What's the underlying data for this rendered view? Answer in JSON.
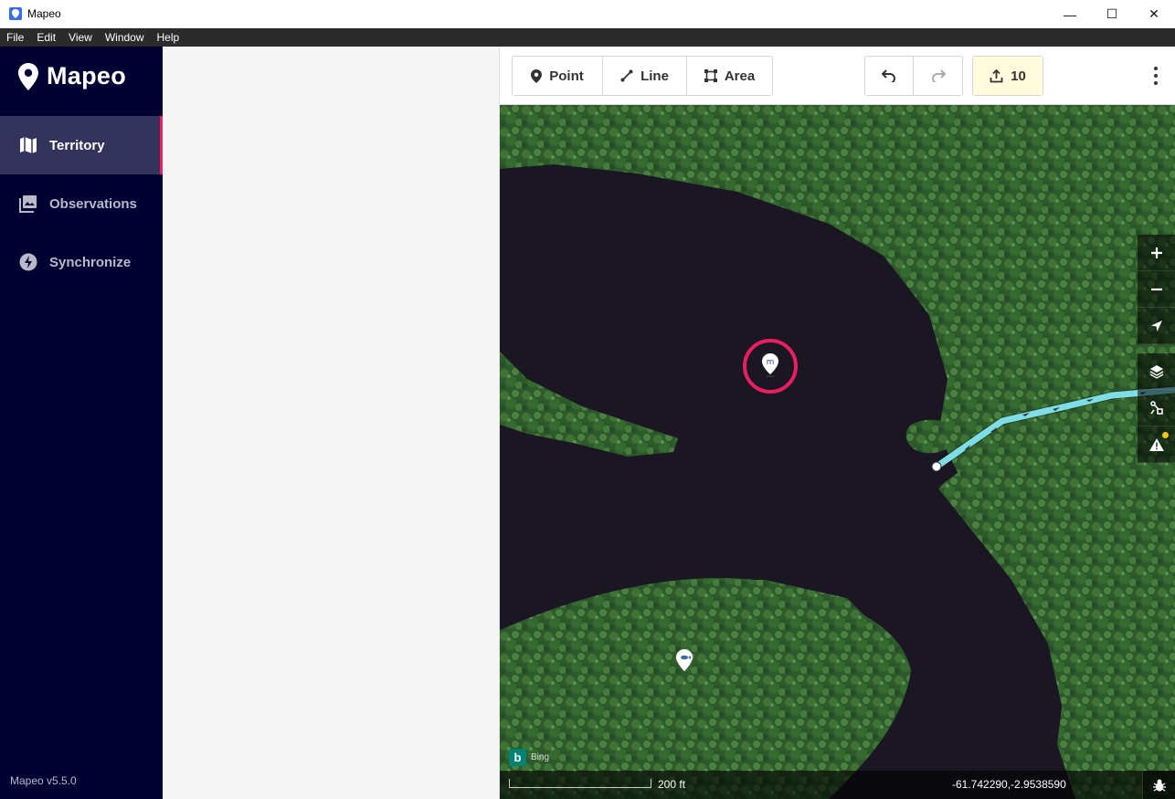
{
  "window": {
    "title": "Mapeo",
    "minimize": "—",
    "maximize": "☐",
    "close": "✕"
  },
  "menu": [
    "File",
    "Edit",
    "View",
    "Window",
    "Help"
  ],
  "sidebar": {
    "logo": "Mapeo",
    "items": [
      {
        "label": "Territory",
        "icon": "map-icon",
        "active": true
      },
      {
        "label": "Observations",
        "icon": "photos-icon",
        "active": false
      },
      {
        "label": "Synchronize",
        "icon": "bolt-icon",
        "active": false
      }
    ],
    "version": "Mapeo v5.5.0"
  },
  "toolbar": {
    "point_label": "Point",
    "line_label": "Line",
    "area_label": "Area",
    "upload_count": "10"
  },
  "map": {
    "attribution": "Bing",
    "scale_label": "200 ft",
    "coordinates": "-61.742290,-2.9538590"
  },
  "colors": {
    "sidebar_bg": "#000033",
    "active_indicator": "#e91e63",
    "line_feature": "#7fdde6",
    "upload_bg": "#fffbdc"
  }
}
